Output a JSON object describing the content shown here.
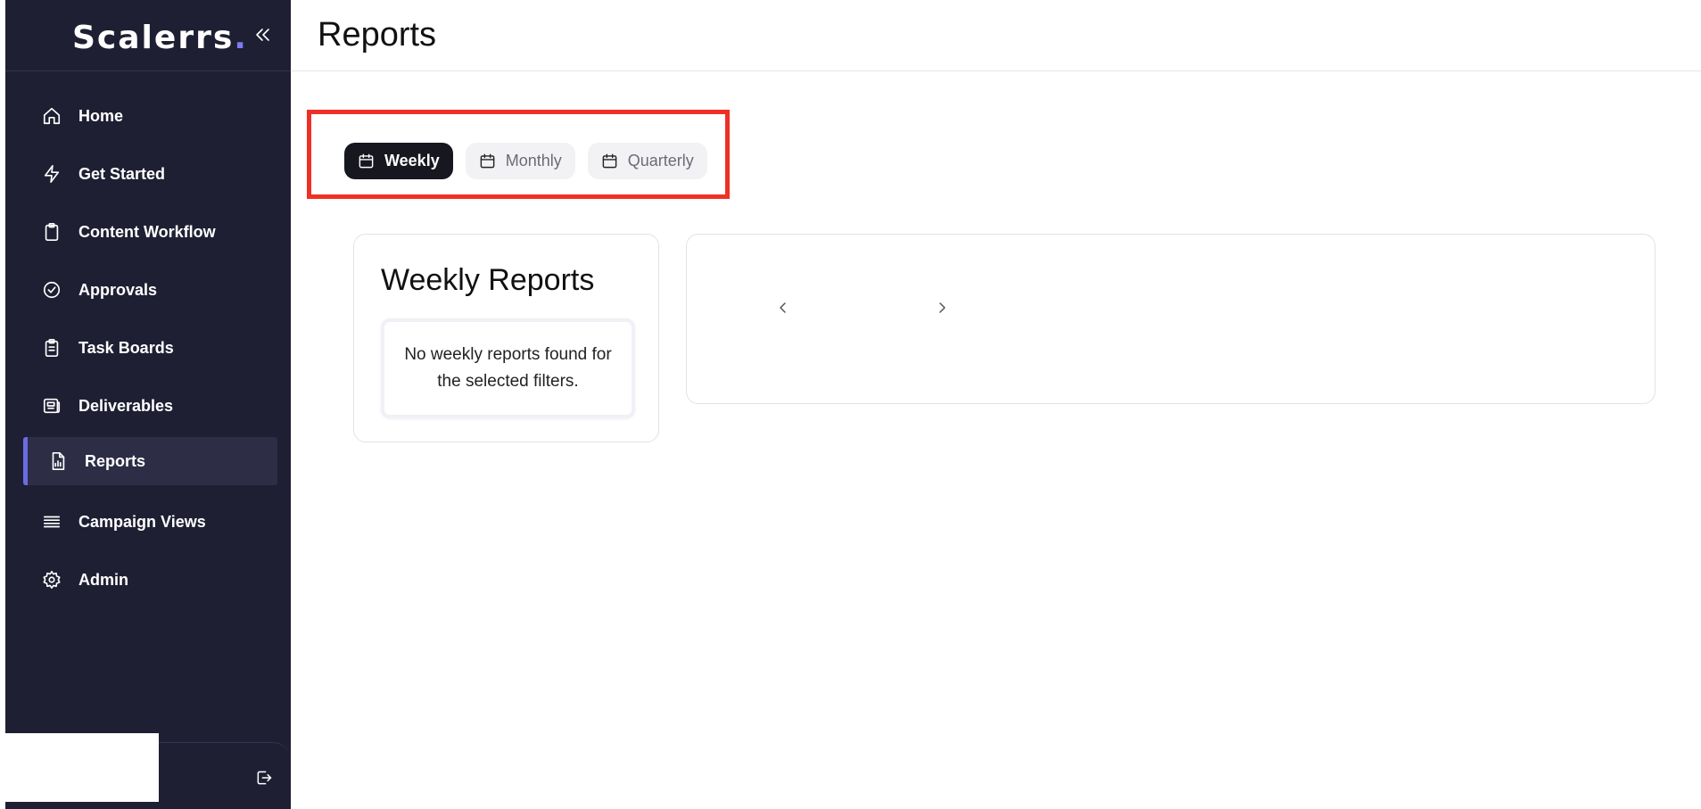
{
  "brand": {
    "name": "Scalerrs",
    "dot": "."
  },
  "sidebar": {
    "items": [
      {
        "label": "Home",
        "icon": "home-icon"
      },
      {
        "label": "Get Started",
        "icon": "lightning-icon"
      },
      {
        "label": "Content Workflow",
        "icon": "clipboard-icon"
      },
      {
        "label": "Approvals",
        "icon": "check-circle-icon"
      },
      {
        "label": "Task Boards",
        "icon": "clipboard-list-icon"
      },
      {
        "label": "Deliverables",
        "icon": "newspaper-icon"
      },
      {
        "label": "Reports",
        "icon": "file-chart-icon",
        "active": true
      },
      {
        "label": "Campaign Views",
        "icon": "list-icon"
      },
      {
        "label": "Admin",
        "icon": "gear-icon"
      }
    ]
  },
  "header": {
    "title": "Reports"
  },
  "tabs": [
    {
      "label": "Weekly",
      "active": true
    },
    {
      "label": "Monthly"
    },
    {
      "label": "Quarterly"
    }
  ],
  "reports_panel": {
    "title": "Weekly Reports",
    "empty_message": "No weekly reports found for the selected filters."
  },
  "colors": {
    "sidebar_bg": "#1f1f33",
    "accent": "#6b6be6",
    "highlight": "#ee3124",
    "active_tab_bg": "#17171f"
  }
}
